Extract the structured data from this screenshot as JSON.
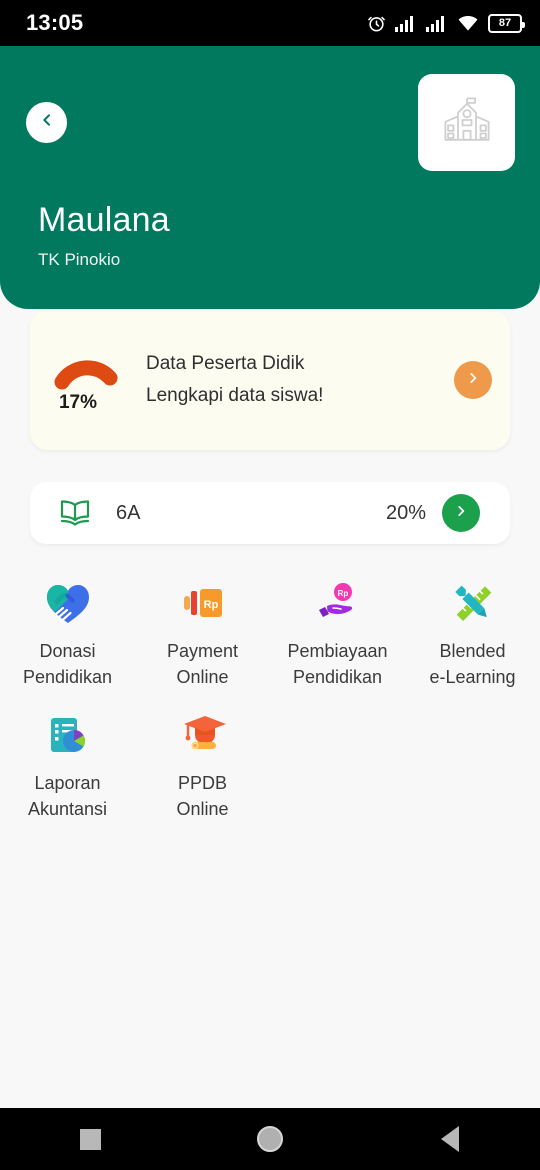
{
  "status_bar": {
    "time": "13:05",
    "battery_level": "87",
    "icons": [
      "alarm-icon",
      "signal-icon-1",
      "signal-icon-2",
      "wifi-icon",
      "battery-icon"
    ]
  },
  "header": {
    "back_icon": "chevron-left-icon",
    "logo_icon": "school-building-icon",
    "name": "Maulana",
    "school": "TK Pinokio",
    "background_color": "#00795E"
  },
  "data_card": {
    "percent": "17%",
    "progress_value": 17,
    "title": "Data Peserta Didik",
    "subtitle": "Lengkapi data siswa!",
    "action_icon": "chevron-right-icon",
    "arc_color": "#DD4A12",
    "button_color": "#EF9A4B",
    "background_color": "#FDFCF0"
  },
  "class_card": {
    "icon": "open-book-icon",
    "label": "6A",
    "percent": "20%",
    "action_icon": "chevron-right-icon",
    "button_color": "#1BA04C",
    "icon_color": "#1E9A4E"
  },
  "menu": {
    "items": [
      {
        "icon": "handshake-heart-icon",
        "label": "Donasi\nPendidikan"
      },
      {
        "icon": "payment-card-rp-icon",
        "label": "Payment\nOnline"
      },
      {
        "icon": "hand-coin-rp-icon",
        "label": "Pembiayaan\nPendidikan"
      },
      {
        "icon": "pencil-ruler-icon",
        "label": "Blended\ne-Learning"
      },
      {
        "icon": "report-chart-icon",
        "label": "Laporan\nAkuntansi"
      },
      {
        "icon": "graduation-cap-icon",
        "label": "PPDB\nOnline"
      }
    ]
  },
  "nav_bar": {
    "recents": "square-icon",
    "home": "circle-icon",
    "back": "triangle-left-icon"
  }
}
